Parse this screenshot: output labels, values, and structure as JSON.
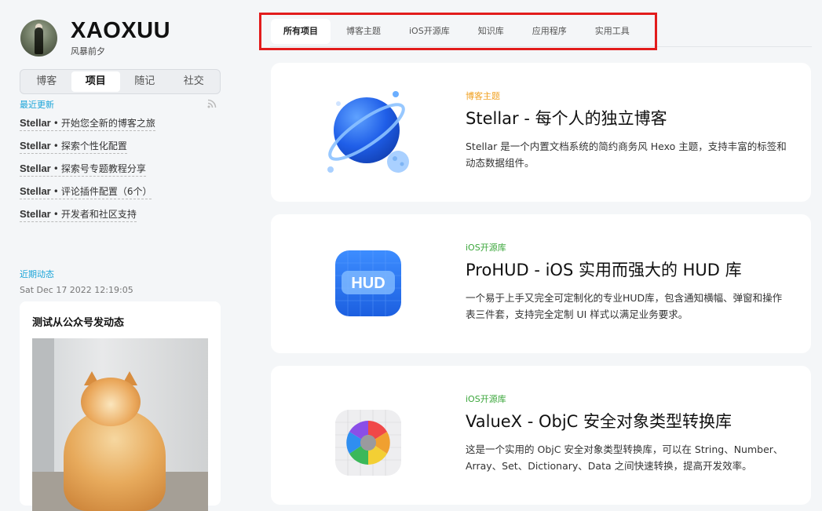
{
  "profile": {
    "title": "XAOXUU",
    "subtitle": "风暴前夕"
  },
  "nav": {
    "tabs": [
      "博客",
      "项目",
      "随记",
      "社交"
    ],
    "active": 1
  },
  "recent": {
    "heading": "最近更新",
    "items": [
      {
        "brand": "Stellar",
        "text": "开始您全新的博客之旅"
      },
      {
        "brand": "Stellar",
        "text": "探索个性化配置"
      },
      {
        "brand": "Stellar",
        "text": "探索号专题教程分享"
      },
      {
        "brand": "Stellar",
        "text": "评论插件配置（6个）"
      },
      {
        "brand": "Stellar",
        "text": "开发者和社区支持"
      }
    ]
  },
  "moments": {
    "heading": "近期动态",
    "date": "Sat Dec 17 2022 12:19:05",
    "card_title": "测试从公众号发动态"
  },
  "tabs": {
    "items": [
      "所有项目",
      "博客主题",
      "iOS开源库",
      "知识库",
      "应用程序",
      "实用工具"
    ],
    "active": 0
  },
  "projects": [
    {
      "category": "博客主题",
      "category_color": "#f0a020",
      "title": "Stellar - 每个人的独立博客",
      "description": "Stellar 是一个内置文档系统的简约商务风 Hexo 主题，支持丰富的标签和动态数据组件。",
      "icon": "planet-icon"
    },
    {
      "category": "iOS开源库",
      "category_color": "#3aa63a",
      "title": "ProHUD - iOS 实用而强大的 HUD 库",
      "description": "一个易于上手又完全可定制化的专业HUD库，包含通知横幅、弹窗和操作表三件套，支持完全定制 UI 样式以满足业务要求。",
      "icon": "hud-app-icon",
      "icon_label": "HUD"
    },
    {
      "category": "iOS开源库",
      "category_color": "#3aa63a",
      "title": "ValueX - ObjC 安全对象类型转换库",
      "description": "这是一个实用的 ObjC 安全对象类型转换库，可以在 String、Number、Array、Set、Dictionary、Data 之间快速转换，提高开发效率。",
      "icon": "valuex-app-icon"
    }
  ]
}
